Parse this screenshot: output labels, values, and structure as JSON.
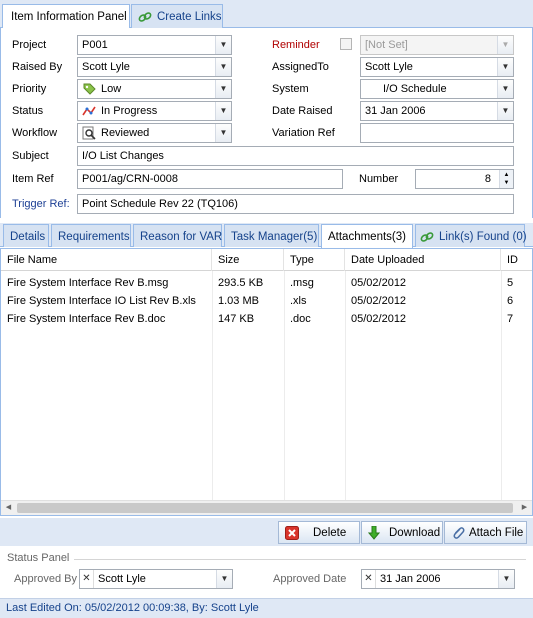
{
  "top_tabs": [
    {
      "label": "Item Information Panel",
      "active": true
    },
    {
      "label": "Create Links",
      "active": false
    }
  ],
  "form": {
    "project_label": "Project",
    "project_value": "P001",
    "reminder_label": "Reminder",
    "reminder_value": "[Not Set]",
    "raised_by_label": "Raised By",
    "raised_by_value": "Scott Lyle",
    "assigned_to_label": "AssignedTo",
    "assigned_to_value": "Scott Lyle",
    "priority_label": "Priority",
    "priority_value": "Low",
    "system_label": "System",
    "system_value": "I/O Schedule",
    "status_label": "Status",
    "status_value": "In Progress",
    "date_raised_label": "Date Raised",
    "date_raised_value": "31 Jan 2006",
    "workflow_label": "Workflow",
    "workflow_value": "Reviewed",
    "variation_ref_label": "Variation Ref",
    "variation_ref_value": "",
    "subject_label": "Subject",
    "subject_value": "I/O List Changes",
    "item_ref_label": "Item Ref",
    "item_ref_value": "P001/ag/CRN-0008",
    "number_label": "Number",
    "number_value": "8",
    "trigger_ref_label": "Trigger Ref:",
    "trigger_ref_value": "Point Schedule Rev 22 (TQ106)"
  },
  "mid_tabs": [
    {
      "label": "Details",
      "active": false
    },
    {
      "label": "Requirements",
      "active": false
    },
    {
      "label": "Reason for VAR",
      "active": false
    },
    {
      "label": "Task Manager(5)",
      "active": false
    },
    {
      "label": "Attachments(3)",
      "active": true
    },
    {
      "label": "Link(s) Found (0)",
      "active": false
    }
  ],
  "grid": {
    "columns": [
      "File Name",
      "Size",
      "Type",
      "Date Uploaded",
      "ID"
    ],
    "rows": [
      [
        "Fire System Interface Rev B.msg",
        "293.5 KB",
        ".msg",
        "05/02/2012",
        "5"
      ],
      [
        "Fire System Interface IO List Rev B.xls",
        "1.03 MB",
        ".xls",
        "05/02/2012",
        "6"
      ],
      [
        "Fire System Interface Rev B.doc",
        "147 KB",
        ".doc",
        "05/02/2012",
        "7"
      ]
    ]
  },
  "buttons": {
    "delete": "Delete",
    "download": "Download",
    "attach": "Attach File"
  },
  "status_panel": {
    "title": "Status Panel",
    "approved_by_label": "Approved By",
    "approved_by_value": "Scott Lyle",
    "approved_date_label": "Approved Date",
    "approved_date_value": "31 Jan 2006"
  },
  "footer": {
    "text": "Last Edited On: 05/02/2012 00:09:38, By: Scott Lyle"
  },
  "colors": {
    "accent": "#15428b",
    "border": "#99bbe8",
    "reminder_label": "#b00000",
    "trigger_label": "#1c3f94"
  }
}
